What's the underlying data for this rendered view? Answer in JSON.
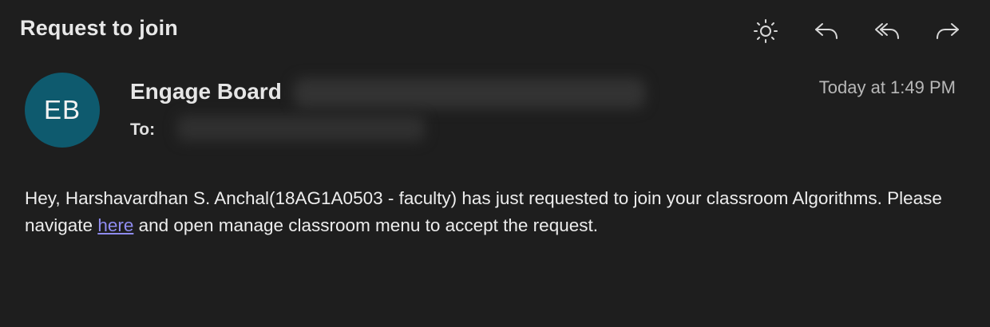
{
  "email": {
    "subject": "Request to join",
    "avatar_initials": "EB",
    "avatar_color": "#0e5a6e",
    "sender_name": "Engage Board",
    "to_label": "To:",
    "timestamp": "Today at 1:49 PM",
    "body": {
      "part1": "Hey, Harshavardhan S. Anchal(18AG1A0503 - faculty) has just requested to join your classroom Algorithms. Please navigate ",
      "link_text": "here",
      "part2": " and open manage classroom menu to accept the request."
    },
    "link_color": "#8f8cf0"
  },
  "toolbar": {
    "icons": [
      "brightness-icon",
      "reply-icon",
      "reply-all-icon",
      "forward-icon"
    ]
  }
}
